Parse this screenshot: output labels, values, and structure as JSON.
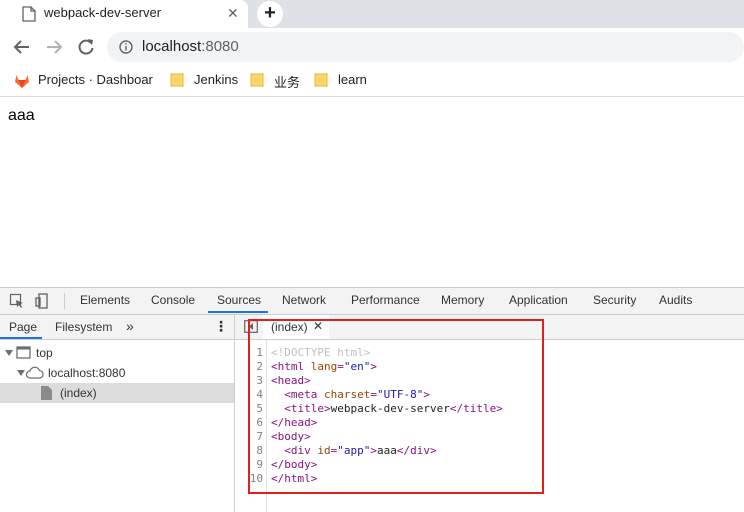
{
  "tab": {
    "title": "webpack-dev-server",
    "close": "✕",
    "new_tab": "+"
  },
  "toolbar": {
    "url_host": "localhost",
    "url_port": ":8080"
  },
  "bookmarks": [
    {
      "label": "Projects · Dashboar",
      "icon": "gitlab-icon"
    },
    {
      "label": "Jenkins",
      "icon": "folder-icon"
    },
    {
      "label": "业务",
      "icon": "folder-icon"
    },
    {
      "label": "learn",
      "icon": "folder-icon"
    }
  ],
  "page": {
    "content": "aaa"
  },
  "devtools": {
    "tabs": [
      "Elements",
      "Console",
      "Sources",
      "Network",
      "Performance",
      "Memory",
      "Application",
      "Security",
      "Audits"
    ],
    "active_tab": "Sources",
    "navigator": {
      "tabs": [
        "Page",
        "Filesystem"
      ],
      "more": "»",
      "menu": "⋮",
      "tree": [
        {
          "label": "top"
        },
        {
          "label": "localhost:8080"
        },
        {
          "label": "(index)"
        }
      ]
    },
    "editor": {
      "file_tab": "(index)",
      "file_close": "✕",
      "lines": [
        {
          "n": "1",
          "parts": [
            [
              "comment",
              "<!DOCTYPE html>"
            ]
          ]
        },
        {
          "n": "2",
          "parts": [
            [
              "tag",
              "<html "
            ],
            [
              "attr",
              "lang"
            ],
            [
              "tag",
              "="
            ],
            [
              "val",
              "\"en\""
            ],
            [
              "tag",
              ">"
            ]
          ]
        },
        {
          "n": "3",
          "parts": [
            [
              "tag",
              "<head>"
            ]
          ]
        },
        {
          "n": "4",
          "parts": [
            [
              "txtc",
              "  "
            ],
            [
              "tag",
              "<meta "
            ],
            [
              "attr",
              "charset"
            ],
            [
              "tag",
              "="
            ],
            [
              "val",
              "\"UTF-8\""
            ],
            [
              "tag",
              ">"
            ]
          ]
        },
        {
          "n": "5",
          "parts": [
            [
              "txtc",
              "  "
            ],
            [
              "tag",
              "<title>"
            ],
            [
              "txtc",
              "webpack-dev-server"
            ],
            [
              "tag",
              "</title>"
            ]
          ]
        },
        {
          "n": "6",
          "parts": [
            [
              "tag",
              "</head>"
            ]
          ]
        },
        {
          "n": "7",
          "parts": [
            [
              "tag",
              "<body>"
            ]
          ]
        },
        {
          "n": "8",
          "parts": [
            [
              "txtc",
              "  "
            ],
            [
              "tag",
              "<div "
            ],
            [
              "attr",
              "id"
            ],
            [
              "tag",
              "="
            ],
            [
              "val",
              "\"app\""
            ],
            [
              "tag",
              ">"
            ],
            [
              "txtc",
              "aaa"
            ],
            [
              "tag",
              "</div>"
            ]
          ]
        },
        {
          "n": "9",
          "parts": [
            [
              "tag",
              "</body>"
            ]
          ]
        },
        {
          "n": "10",
          "parts": [
            [
              "tag",
              "</html>"
            ]
          ]
        }
      ]
    }
  },
  "colors": {
    "accent": "#1a73e8",
    "highlight": "#e02020"
  }
}
